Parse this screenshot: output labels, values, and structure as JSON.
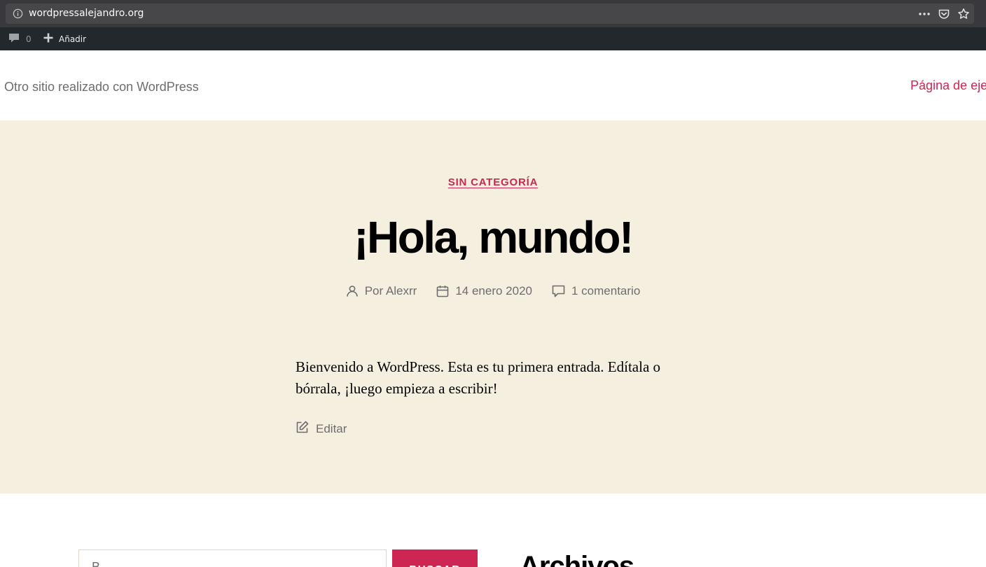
{
  "browser": {
    "url": "wordpressalejandro.org",
    "icons": [
      "info-icon",
      "more-icon",
      "pocket-icon",
      "bookmark-star-icon"
    ]
  },
  "admin_bar": {
    "comments_count": "0",
    "new_label": "Añadir"
  },
  "header": {
    "site_description": "Otro sitio realizado con WordPress",
    "nav_item": "Página de eje"
  },
  "post": {
    "category": "SIN CATEGORÍA",
    "title": "¡Hola, mundo!",
    "author": "Por Alexrr",
    "date": "14 enero 2020",
    "comments": "1 comentario",
    "content": "Bienvenido a WordPress. Esta es tu primera entrada. Edítala o bórrala, ¡luego empieza a escribir!",
    "edit_label": "Editar"
  },
  "widgets": {
    "search_placeholder": "B",
    "search_button": "BUSCAR",
    "archives_title": "Archivos"
  },
  "colors": {
    "accent": "#cd2653",
    "background": "#f5efe0",
    "admin_bar": "#23282d",
    "browser_bar": "#38383d"
  }
}
